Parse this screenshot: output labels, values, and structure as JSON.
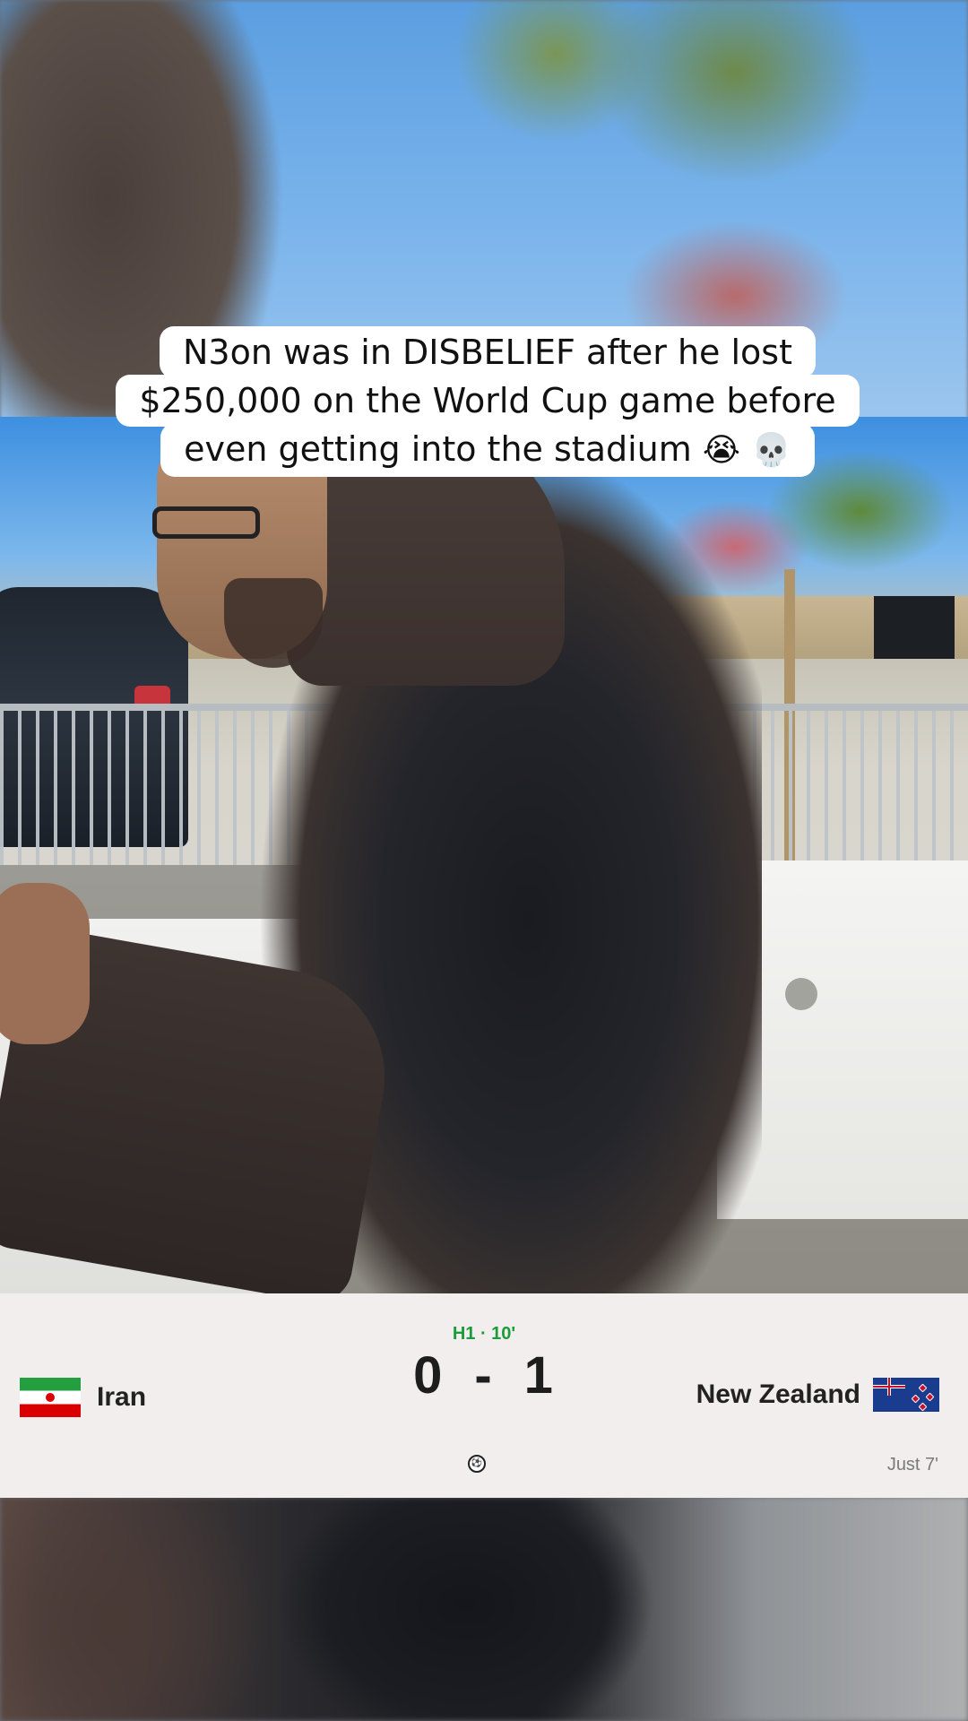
{
  "caption": {
    "line1": "N3on was in DISBELIEF after he lost",
    "line2": "$250,000 on the World Cup game before",
    "line3": "even getting into the stadium",
    "emojis": [
      "😭",
      "💀"
    ]
  },
  "scoreboard": {
    "period": "H1 · 10'",
    "home_team": {
      "name": "Iran",
      "flag": "iran-flag-icon"
    },
    "away_team": {
      "name": "New Zealand",
      "flag": "new-zealand-flag-icon"
    },
    "home_score": "0",
    "separator": "-",
    "away_score": "1",
    "goal_icon": "soccer-ball-icon",
    "goal_event": "Just 7'"
  },
  "colors": {
    "period_green": "#1c9b3a",
    "scoreboard_bg": "#f1eeed",
    "caption_bg": "#ffffff"
  }
}
